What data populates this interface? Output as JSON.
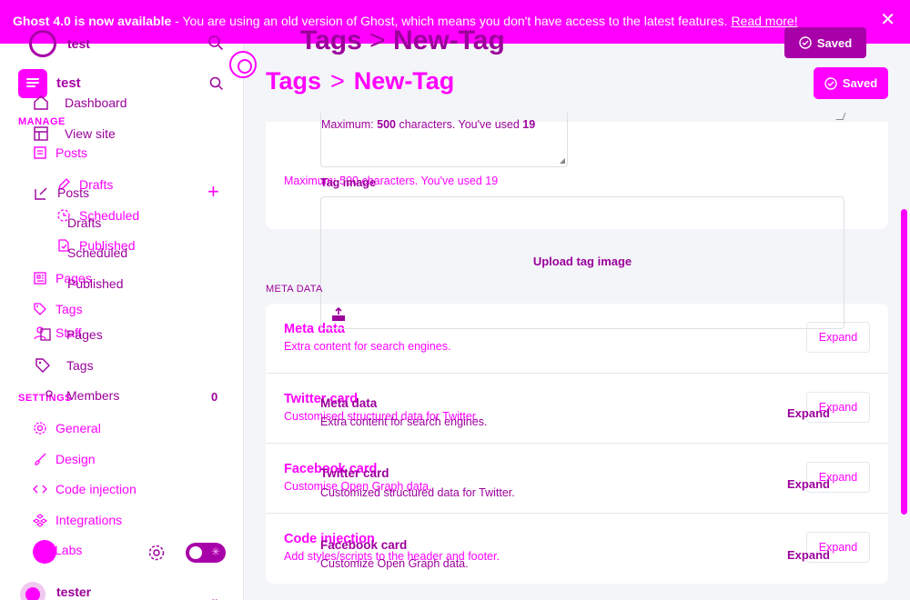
{
  "banner": {
    "bold": "Ghost 4.0 is now available",
    "text": " - You are using an old version of Ghost, which means you don't have access to the latest features. ",
    "link": "Read more!",
    "close": "✕"
  },
  "ghost": {
    "site_title": "test",
    "crumb_root": "Tags",
    "crumb_sep": ">",
    "crumb_current": "New-Tag",
    "saved_label": "Saved"
  },
  "sidebar": {
    "site_title": "test",
    "manage_heading": "MANAGE",
    "settings_heading": "SETTINGS",
    "nav_back": [
      "Dashboard",
      "View site",
      "Posts",
      "Drafts",
      "Scheduled",
      "Published",
      "Pages",
      "Tags",
      "Members"
    ],
    "nav": {
      "posts": "Posts",
      "drafts": "Drafts",
      "scheduled": "Scheduled",
      "published": "Published",
      "pages": "Pages",
      "tags": "Tags",
      "staff": "Staff",
      "members_count": "0",
      "general": "General",
      "design": "Design",
      "code_injection": "Code injection",
      "integrations": "Integrations",
      "labs": "Labs"
    },
    "user_name": "tester"
  },
  "header": {
    "crumb_root": "Tags",
    "crumb_sep": ">",
    "crumb_current": "New-Tag",
    "saved_label": "Saved"
  },
  "form": {
    "char_hint_bold_prefix": "Maximum: ",
    "char_hint_bold": "500",
    "char_hint_mid": " characters. You've used ",
    "char_hint_count": "19",
    "char_hint_plain": "Maximum: 500 characters. You've used 19",
    "tag_image_label": "Tag image",
    "upload_label": "Upload tag image"
  },
  "meta": {
    "section_label": "META DATA",
    "rows": [
      {
        "title": "Meta data",
        "desc": "Extra content for search engines.",
        "expand": "Expand"
      },
      {
        "title": "Twitter card",
        "desc": "Customised structured data for Twitter.",
        "expand": "Expand"
      },
      {
        "title": "Facebook card",
        "desc": "Customise Open Graph data.",
        "expand": "Expand"
      },
      {
        "title": "Code injection",
        "desc": "Add styles/scripts to the header and footer.",
        "expand": "Expand"
      }
    ],
    "overlay": [
      {
        "title": "Meta data",
        "desc": "Extra content for search engines.",
        "expand": "Expand"
      },
      {
        "title": "Twitter card",
        "desc": "Customized structured data for Twitter.",
        "expand": "Expand"
      },
      {
        "title": "Facebook card",
        "desc": "Customize Open Graph data.",
        "expand": "Expand"
      }
    ]
  },
  "colors": {
    "accent": "#ff00ff",
    "accent_dark": "#a800a8",
    "text_dark": "#9b009b"
  }
}
